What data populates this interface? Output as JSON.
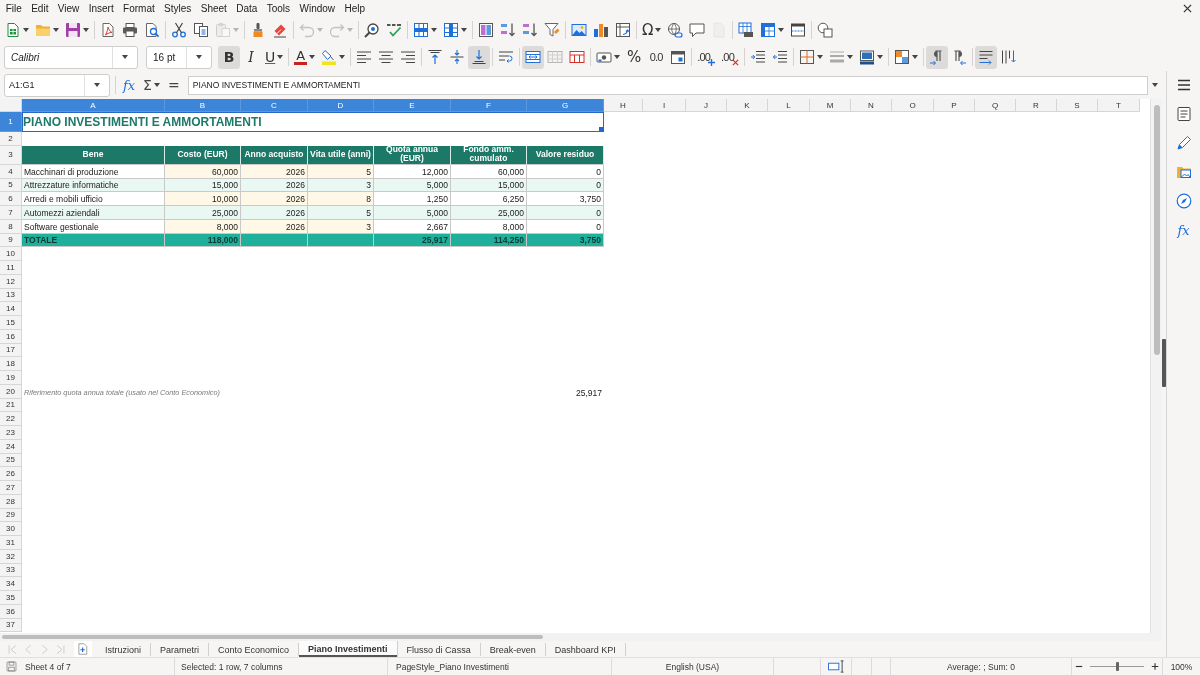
{
  "menu_bar": [
    "File",
    "Edit",
    "View",
    "Insert",
    "Format",
    "Styles",
    "Sheet",
    "Data",
    "Tools",
    "Window",
    "Help"
  ],
  "standard_toolbar": {
    "buttons": [
      {
        "kind": "icon",
        "disabled": false
      },
      {
        "kind": "icon",
        "disabled": false
      },
      {
        "kind": "icon",
        "disabled": false
      },
      {
        "kind": "icon",
        "disabled": false
      },
      {
        "kind": "icon",
        "disabled": false
      },
      {
        "kind": "icon",
        "disabled": false
      },
      {
        "kind": "icon",
        "disabled": false
      },
      {
        "kind": "icon",
        "disabled": false
      },
      {
        "kind": "icon",
        "disabled": true
      },
      {
        "kind": "icon",
        "disabled": false
      },
      {
        "kind": "icon",
        "disabled": false
      },
      {
        "kind": "icon",
        "disabled": true
      },
      {
        "kind": "icon",
        "disabled": true
      },
      {
        "kind": "icon",
        "disabled": false
      },
      {
        "kind": "icon",
        "disabled": false
      },
      {
        "kind": "icon",
        "disabled": false
      },
      {
        "kind": "icon",
        "disabled": false
      },
      {
        "kind": "icon",
        "disabled": false
      },
      {
        "kind": "icon",
        "disabled": false
      },
      {
        "kind": "icon",
        "disabled": false
      },
      {
        "kind": "icon",
        "disabled": false
      },
      {
        "kind": "icon",
        "disabled": false
      },
      {
        "kind": "icon",
        "disabled": false
      },
      {
        "kind": "icon",
        "disabled": false
      },
      {
        "kind": "text",
        "label": "Ω",
        "disabled": false
      },
      {
        "kind": "icon",
        "disabled": false
      },
      {
        "kind": "icon",
        "disabled": false
      },
      {
        "kind": "icon",
        "disabled": true
      },
      {
        "kind": "icon",
        "disabled": false
      },
      {
        "kind": "icon",
        "disabled": false
      },
      {
        "kind": "icon",
        "disabled": false
      },
      {
        "kind": "icon",
        "disabled": false
      }
    ]
  },
  "formatting_toolbar": {
    "font_name": "Calibri",
    "font_size": "16 pt",
    "buttons": [
      {
        "kind": "text",
        "label": "B",
        "pressed": true
      },
      {
        "kind": "text",
        "label": "I",
        "pressed": false
      },
      {
        "kind": "text",
        "label": "U",
        "pressed": false
      },
      {
        "kind": "text",
        "label": "A",
        "pressed": false
      },
      {
        "kind": "icon",
        "pressed": false
      },
      {
        "kind": "icon",
        "pressed": false
      },
      {
        "kind": "icon",
        "pressed": false
      },
      {
        "kind": "icon",
        "pressed": false
      },
      {
        "kind": "icon",
        "pressed": false
      },
      {
        "kind": "icon",
        "pressed": false
      },
      {
        "kind": "icon",
        "pressed": true
      },
      {
        "kind": "icon",
        "pressed": false
      },
      {
        "kind": "icon",
        "pressed": true
      },
      {
        "kind": "icon",
        "pressed": false
      },
      {
        "kind": "icon",
        "pressed": false
      },
      {
        "kind": "icon",
        "pressed": false
      },
      {
        "kind": "text",
        "label": "%",
        "pressed": false
      },
      {
        "kind": "text",
        "label": "0.0",
        "pressed": false
      },
      {
        "kind": "icon",
        "pressed": false
      },
      {
        "kind": "text",
        "label": ".00",
        "pressed": false
      },
      {
        "kind": "text",
        "label": ".00",
        "pressed": false
      },
      {
        "kind": "icon",
        "pressed": false
      },
      {
        "kind": "icon",
        "pressed": false
      },
      {
        "kind": "icon",
        "pressed": false
      },
      {
        "kind": "icon",
        "pressed": false
      },
      {
        "kind": "icon",
        "pressed": false
      },
      {
        "kind": "icon",
        "pressed": false
      },
      {
        "kind": "icon",
        "pressed": true
      },
      {
        "kind": "icon",
        "pressed": false
      },
      {
        "kind": "icon",
        "pressed": true
      },
      {
        "kind": "icon",
        "pressed": false
      }
    ]
  },
  "formula_bar": {
    "name_box": "A1:G1",
    "function_wizard": "fx",
    "sum": "Σ",
    "equals": "=",
    "content": "PIANO INVESTIMENTI E AMMORTAMENTI"
  },
  "sheet": {
    "columns": [
      {
        "label": "A",
        "selected": true
      },
      {
        "label": "B",
        "selected": true
      },
      {
        "label": "C",
        "selected": true
      },
      {
        "label": "D",
        "selected": true
      },
      {
        "label": "E",
        "selected": true
      },
      {
        "label": "F",
        "selected": true
      },
      {
        "label": "G",
        "selected": true
      },
      {
        "label": "H",
        "selected": false
      },
      {
        "label": "I",
        "selected": false
      },
      {
        "label": "J",
        "selected": false
      },
      {
        "label": "K",
        "selected": false
      },
      {
        "label": "L",
        "selected": false
      },
      {
        "label": "M",
        "selected": false
      },
      {
        "label": "N",
        "selected": false
      },
      {
        "label": "O",
        "selected": false
      },
      {
        "label": "P",
        "selected": false
      },
      {
        "label": "Q",
        "selected": false
      },
      {
        "label": "R",
        "selected": false
      },
      {
        "label": "S",
        "selected": false
      },
      {
        "label": "T",
        "selected": false
      }
    ],
    "rows": [
      {
        "label": "1",
        "selected": true,
        "kind": "title",
        "cells": [
          {
            "kind": "label",
            "text": "PIANO INVESTIMENTI E AMMORTAMENTI"
          }
        ]
      },
      {
        "label": "2",
        "selected": false,
        "kind": "empty"
      },
      {
        "label": "3",
        "selected": false,
        "kind": "header",
        "cells": [
          {
            "kind": "label",
            "text": "Bene"
          },
          {
            "kind": "label",
            "text": "Costo (EUR)"
          },
          {
            "kind": "label",
            "text": "Anno acquisto"
          },
          {
            "kind": "label",
            "text": "Vita utile (anni)"
          },
          {
            "kind": "label",
            "text": "Quota annua (EUR)"
          },
          {
            "kind": "label",
            "text": "Fondo amm. cumulato"
          },
          {
            "kind": "label",
            "text": "Valore residuo"
          }
        ]
      },
      {
        "label": "4",
        "selected": false,
        "kind": "data",
        "cells": [
          {
            "kind": "label",
            "text": "Macchinari di produzione"
          },
          {
            "kind": "input",
            "text": "60,000"
          },
          {
            "kind": "input",
            "text": "2026"
          },
          {
            "kind": "input",
            "text": "5"
          },
          {
            "kind": "formula",
            "text": "12,000"
          },
          {
            "kind": "formula",
            "text": "60,000"
          },
          {
            "kind": "formula",
            "text": "0"
          }
        ]
      },
      {
        "label": "5",
        "selected": false,
        "kind": "band",
        "cells": [
          {
            "kind": "label",
            "text": "Attrezzature informatiche"
          },
          {
            "kind": "input",
            "text": "15,000"
          },
          {
            "kind": "input",
            "text": "2026"
          },
          {
            "kind": "input",
            "text": "3"
          },
          {
            "kind": "formula",
            "text": "5,000"
          },
          {
            "kind": "formula",
            "text": "15,000"
          },
          {
            "kind": "formula",
            "text": "0"
          }
        ]
      },
      {
        "label": "6",
        "selected": false,
        "kind": "data",
        "cells": [
          {
            "kind": "label",
            "text": "Arredi e mobili ufficio"
          },
          {
            "kind": "input",
            "text": "10,000"
          },
          {
            "kind": "input",
            "text": "2026"
          },
          {
            "kind": "input",
            "text": "8"
          },
          {
            "kind": "formula",
            "text": "1,250"
          },
          {
            "kind": "formula",
            "text": "6,250"
          },
          {
            "kind": "formula",
            "text": "3,750"
          }
        ]
      },
      {
        "label": "7",
        "selected": false,
        "kind": "band",
        "cells": [
          {
            "kind": "label",
            "text": "Automezzi aziendali"
          },
          {
            "kind": "input",
            "text": "25,000"
          },
          {
            "kind": "input",
            "text": "2026"
          },
          {
            "kind": "input",
            "text": "5"
          },
          {
            "kind": "formula",
            "text": "5,000"
          },
          {
            "kind": "formula",
            "text": "25,000"
          },
          {
            "kind": "formula",
            "text": "0"
          }
        ]
      },
      {
        "label": "8",
        "selected": false,
        "kind": "data",
        "cells": [
          {
            "kind": "label",
            "text": "Software gestionale"
          },
          {
            "kind": "input",
            "text": "8,000"
          },
          {
            "kind": "input",
            "text": "2026"
          },
          {
            "kind": "input",
            "text": "3"
          },
          {
            "kind": "formula",
            "text": "2,667"
          },
          {
            "kind": "formula",
            "text": "8,000"
          },
          {
            "kind": "formula",
            "text": "0"
          }
        ]
      },
      {
        "label": "9",
        "selected": false,
        "kind": "total",
        "cells": [
          {
            "kind": "label",
            "text": "TOTALE"
          },
          {
            "kind": "formula",
            "text": "118,000"
          },
          {
            "kind": "empty"
          },
          {
            "kind": "empty"
          },
          {
            "kind": "formula",
            "text": "25,917"
          },
          {
            "kind": "formula",
            "text": "114,250"
          },
          {
            "kind": "formula",
            "text": "3,750"
          }
        ]
      },
      {
        "label": "10",
        "selected": false,
        "kind": "empty"
      },
      {
        "label": "11",
        "selected": false,
        "kind": "empty"
      },
      {
        "label": "12",
        "selected": false,
        "kind": "empty"
      },
      {
        "label": "13",
        "selected": false,
        "kind": "empty"
      },
      {
        "label": "14",
        "selected": false,
        "kind": "empty"
      },
      {
        "label": "15",
        "selected": false,
        "kind": "empty"
      },
      {
        "label": "16",
        "selected": false,
        "kind": "empty"
      },
      {
        "label": "17",
        "selected": false,
        "kind": "empty"
      },
      {
        "label": "18",
        "selected": false,
        "kind": "empty"
      },
      {
        "label": "19",
        "selected": false,
        "kind": "empty"
      },
      {
        "label": "20",
        "selected": false,
        "kind": "note",
        "cells": [
          {
            "kind": "note",
            "text": "Riferimento quota annua totale (usato nel Conto Economico)"
          },
          {
            "kind": "empty"
          },
          {
            "kind": "empty"
          },
          {
            "kind": "empty"
          },
          {
            "kind": "empty"
          },
          {
            "kind": "empty"
          },
          {
            "kind": "formula",
            "text": "25,917"
          }
        ]
      },
      {
        "label": "21",
        "selected": false,
        "kind": "empty"
      },
      {
        "label": "22",
        "selected": false,
        "kind": "empty"
      },
      {
        "label": "23",
        "selected": false,
        "kind": "empty"
      },
      {
        "label": "24",
        "selected": false,
        "kind": "empty"
      },
      {
        "label": "25",
        "selected": false,
        "kind": "empty"
      },
      {
        "label": "26",
        "selected": false,
        "kind": "empty"
      },
      {
        "label": "27",
        "selected": false,
        "kind": "empty"
      },
      {
        "label": "28",
        "selected": false,
        "kind": "empty"
      },
      {
        "label": "29",
        "selected": false,
        "kind": "empty"
      },
      {
        "label": "30",
        "selected": false,
        "kind": "empty"
      },
      {
        "label": "31",
        "selected": false,
        "kind": "empty"
      },
      {
        "label": "32",
        "selected": false,
        "kind": "empty"
      },
      {
        "label": "33",
        "selected": false,
        "kind": "empty"
      },
      {
        "label": "34",
        "selected": false,
        "kind": "empty"
      },
      {
        "label": "35",
        "selected": false,
        "kind": "empty"
      },
      {
        "label": "36",
        "selected": false,
        "kind": "empty"
      },
      {
        "label": "37",
        "selected": false,
        "kind": "empty"
      }
    ]
  },
  "sheet_tabs": {
    "navigation": [
      {
        "disabled": true
      },
      {
        "disabled": true
      },
      {
        "disabled": true
      },
      {
        "disabled": true
      }
    ],
    "tabs": [
      {
        "label": "Istruzioni",
        "selected": false
      },
      {
        "label": "Parametri",
        "selected": false
      },
      {
        "label": "Conto Economico",
        "selected": false
      },
      {
        "label": "Piano Investimenti",
        "selected": true
      },
      {
        "label": "Flusso di Cassa",
        "selected": false
      },
      {
        "label": "Break-even",
        "selected": false
      },
      {
        "label": "Dashboard KPI",
        "selected": false
      }
    ]
  },
  "sidebar": {
    "functions_button": "fx"
  },
  "status_bar": {
    "sheet_position": "Sheet 4 of 7",
    "selection": "Selected: 1 row, 7 columns",
    "page_style": "PageStyle_Piano Investimenti",
    "language": "English (USA)",
    "summary": "Average: ; Sum: 0",
    "zoom": {
      "level": 0.5,
      "label": "100%"
    }
  }
}
